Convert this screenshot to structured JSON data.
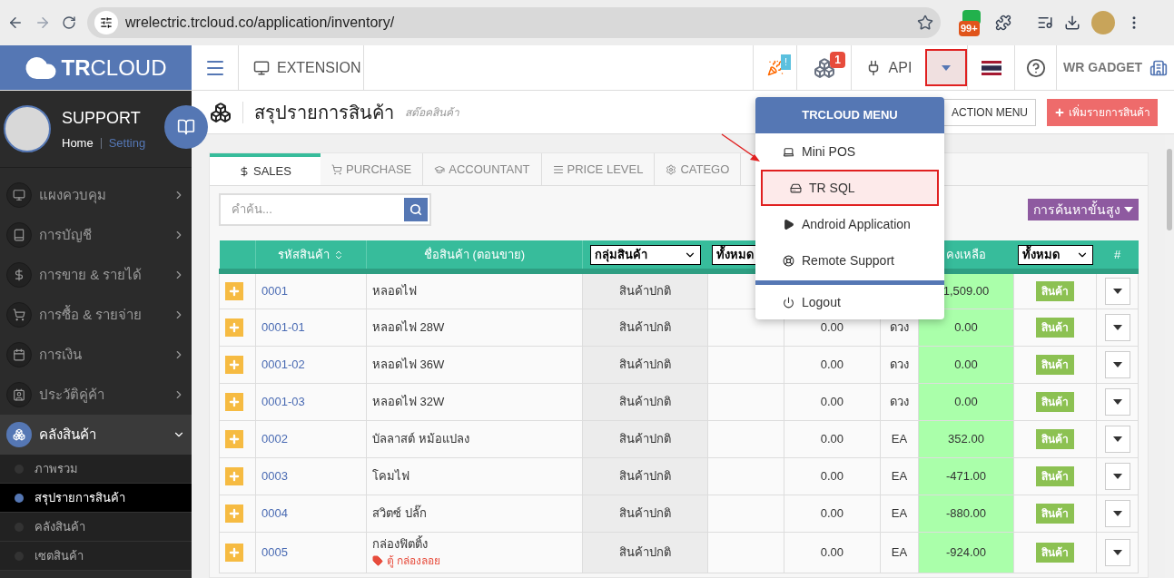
{
  "browser": {
    "url": "wrelectric.trcloud.co/application/inventory/",
    "extension_badge": "99+"
  },
  "header": {
    "logo": "TRCLOUD",
    "extension": "EXTENSION",
    "party_badge": "!",
    "cubes_badge": "1",
    "api": "API",
    "company": "WR GADGET"
  },
  "profile": {
    "name": "SUPPORT",
    "home": "Home",
    "setting": "Setting"
  },
  "sidebar": {
    "items": [
      {
        "label": "แผงควบคุม",
        "expanded": false
      },
      {
        "label": "การบัญชี",
        "expanded": false
      },
      {
        "label": "การขาย & รายได้",
        "expanded": false
      },
      {
        "label": "การซื้อ & รายจ่าย",
        "expanded": false
      },
      {
        "label": "การเงิน",
        "expanded": false
      },
      {
        "label": "ประวัติคู่ค้า",
        "expanded": false
      },
      {
        "label": "คลังสินค้า",
        "expanded": true,
        "children": [
          {
            "label": "ภาพรวม",
            "selected": false
          },
          {
            "label": "สรุปรายการสินค้า",
            "selected": true
          },
          {
            "label": "คลังสินค้า",
            "selected": false
          },
          {
            "label": "เซตสินค้า",
            "selected": false
          }
        ]
      }
    ]
  },
  "page": {
    "title": "สรุปรายการสินค้า",
    "subtitle": "สต๊อคสินค้า",
    "action_menu": "ACTION MENU",
    "add_button": "เพิ่มรายการสินค้า"
  },
  "tabs": [
    {
      "label": "SALES",
      "selected": true
    },
    {
      "label": "PURCHASE",
      "selected": false
    },
    {
      "label": "ACCOUNTANT",
      "selected": false
    },
    {
      "label": "PRICE LEVEL",
      "selected": false
    },
    {
      "label": "CATEGO",
      "selected": false
    }
  ],
  "search": {
    "placeholder": "คำค้น..."
  },
  "advanced_search": "การค้นหาขั้นสูง",
  "table": {
    "columns": {
      "code": "รหัสสินค้า",
      "name": "ชื่อสินค้า (ตอนขาย)",
      "group_select": "กลุ่มสินค้า",
      "filter_select": "ทั้งหมด",
      "balance": "คงเหลือ",
      "type_select": "ทั้งหมด",
      "actions": "#"
    },
    "rows": [
      {
        "code": "0001",
        "name": "หลอดไฟ",
        "group": "สินค้าปกติ",
        "balance": "1,509.00",
        "type": "สินค้า"
      },
      {
        "code": "0001-01",
        "name": "หลอดไฟ 28W",
        "group": "สินค้าปกติ",
        "value": "0.00",
        "unit": "ดวง",
        "balance": "0.00",
        "type": "สินค้า"
      },
      {
        "code": "0001-02",
        "name": "หลอดไฟ 36W",
        "group": "สินค้าปกติ",
        "value": "0.00",
        "unit": "ดวง",
        "balance": "0.00",
        "type": "สินค้า"
      },
      {
        "code": "0001-03",
        "name": "หลอดไฟ 32W",
        "group": "สินค้าปกติ",
        "value": "0.00",
        "unit": "ดวง",
        "balance": "0.00",
        "type": "สินค้า"
      },
      {
        "code": "0002",
        "name": "บัลลาสต์ หม้อแปลง",
        "group": "สินค้าปกติ",
        "value": "0.00",
        "unit": "EA",
        "balance": "352.00",
        "type": "สินค้า"
      },
      {
        "code": "0003",
        "name": "โคมไฟ",
        "group": "สินค้าปกติ",
        "value": "0.00",
        "unit": "EA",
        "balance": "-471.00",
        "type": "สินค้า"
      },
      {
        "code": "0004",
        "name": "สวิตซ์ ปลั๊ก",
        "group": "สินค้าปกติ",
        "value": "0.00",
        "unit": "EA",
        "balance": "-880.00",
        "type": "สินค้า"
      },
      {
        "code": "0005",
        "name": "กล่องฟิตติ้ง",
        "tag": "ตู้ กล่องลอย",
        "group": "สินค้าปกติ",
        "value": "0.00",
        "unit": "EA",
        "balance": "-924.00",
        "type": "สินค้า"
      }
    ]
  },
  "menu": {
    "title": "TRCLOUD MENU",
    "items": [
      {
        "label": "Mini POS",
        "selected": false
      },
      {
        "label": "TR SQL",
        "selected": true
      },
      {
        "label": "Android Application",
        "selected": false
      },
      {
        "label": "Remote Support",
        "selected": false
      }
    ],
    "logout": "Logout"
  }
}
